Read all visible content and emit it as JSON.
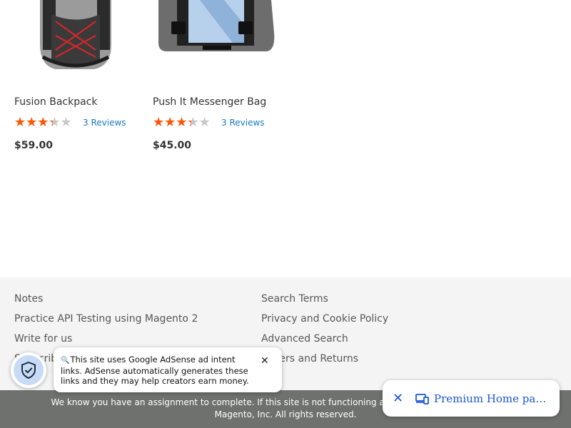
{
  "products": [
    {
      "name": "Fusion Backpack",
      "image_name": "fusion-backpack-image",
      "rating_fraction": 0.6,
      "reviews_label": "3 Reviews",
      "price": "$59.00"
    },
    {
      "name": "Push It Messenger Bag",
      "image_name": "messenger-bag-image",
      "rating_fraction": 0.6,
      "reviews_label": "3 Reviews",
      "price": "$45.00"
    }
  ],
  "footer": {
    "col1": [
      "Notes",
      "Practice API Testing using Magento 2",
      "Write for us",
      "Subscribe"
    ],
    "col2": [
      "Search Terms",
      "Privacy and Cookie Policy",
      "Advanced Search",
      "Orders and Returns"
    ]
  },
  "notice": {
    "text_before": "We know you have an assignment to complete. If this site is not functioning as expected, drop us an email at",
    "link": "Magento",
    "text_after": ", Inc. All rights reserved."
  },
  "ads_popup": {
    "text": "This site uses Google AdSense ad intent links. AdSense automatically generates these links and they may help creators earn money."
  },
  "link_chip": {
    "label": "Premium Home page …"
  },
  "colors": {
    "star_active": "#ff5501",
    "star_inactive": "#c7c7c7",
    "link_blue": "#1979c3",
    "footer_bg": "#f4f4f4",
    "notice_bg": "#6e716e",
    "chip_blue": "#1a56db"
  },
  "icons": [
    "shield-check-icon",
    "magnifier-icon",
    "close-icon",
    "devices-icon"
  ]
}
